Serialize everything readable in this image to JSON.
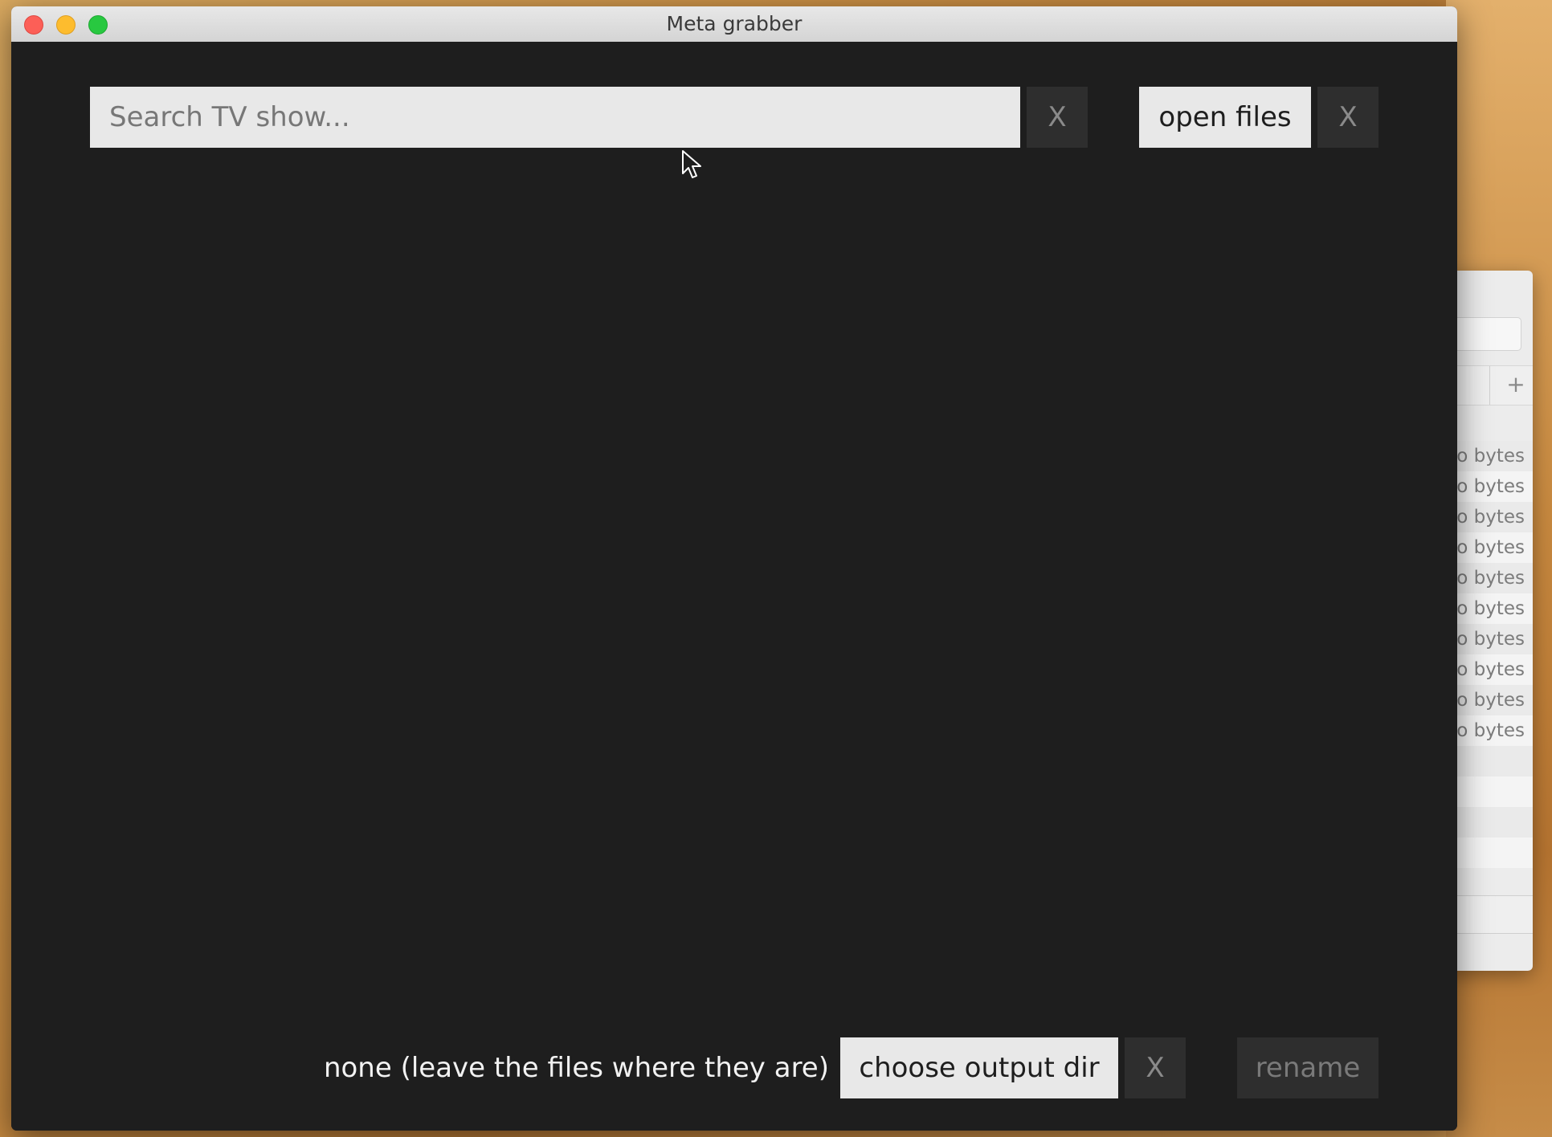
{
  "window": {
    "title": "Meta grabber"
  },
  "search": {
    "placeholder": "Search TV show...",
    "value": "",
    "clear_label": "X"
  },
  "files": {
    "open_label": "open files",
    "clear_label": "X"
  },
  "output": {
    "current_dir": "none (leave the files where they are)",
    "choose_label": "choose output dir",
    "clear_label": "X"
  },
  "actions": {
    "rename_label": "rename"
  },
  "background_window": {
    "rows": [
      "o bytes",
      "o bytes",
      "o bytes",
      "o bytes",
      "o bytes",
      "o bytes",
      "o bytes",
      "o bytes",
      "o bytes",
      "o bytes"
    ],
    "add_label": "+"
  },
  "colors": {
    "window_bg": "#1e1e1e",
    "button_light": "#e8e8e8",
    "button_dark": "#2e2e2e",
    "close": "#fc5f57",
    "minimize": "#fdbc2e",
    "maximize": "#28c840"
  }
}
